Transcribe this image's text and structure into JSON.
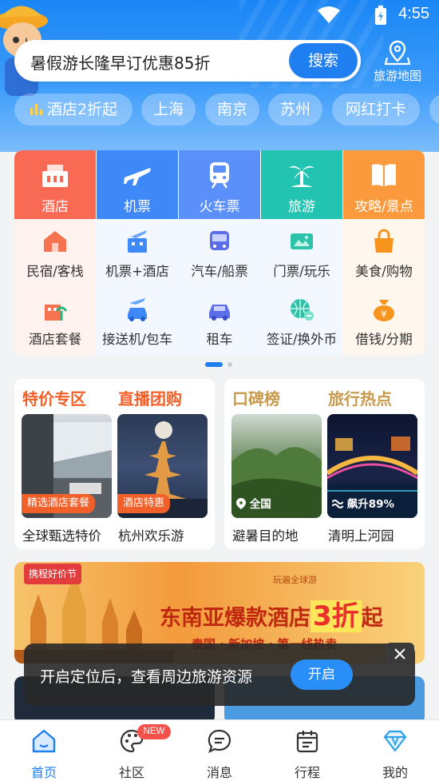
{
  "status_bar": {
    "time": "4:55"
  },
  "search": {
    "placeholder": "暑假游长隆早订优惠85折",
    "button": "搜索"
  },
  "map_button": {
    "label": "旅游地图"
  },
  "quick_tags": [
    "酒店2折起",
    "上海",
    "南京",
    "苏州",
    "网红打卡"
  ],
  "top_services": [
    {
      "label": "酒店",
      "color": "#f96a55",
      "icon": "hotel-icon"
    },
    {
      "label": "机票",
      "color": "#3f88f8",
      "icon": "plane-icon"
    },
    {
      "label": "火车票",
      "color": "#5b8ff9",
      "icon": "train-icon"
    },
    {
      "label": "旅游",
      "color": "#22c4b1",
      "icon": "palm-icon"
    },
    {
      "label": "攻略/景点",
      "color": "#fb9a3c",
      "icon": "book-icon"
    }
  ],
  "sub_services": [
    [
      {
        "label": "民宿/客栈",
        "icon": "house-icon"
      },
      {
        "label": "机票+酒店",
        "icon": "plane-hotel-icon"
      },
      {
        "label": "汽车/船票",
        "icon": "bus-icon"
      },
      {
        "label": "门票/玩乐",
        "icon": "ticket-icon"
      },
      {
        "label": "美食/购物",
        "icon": "shopping-bag-icon"
      }
    ],
    [
      {
        "label": "酒店套餐",
        "icon": "hotel-package-icon"
      },
      {
        "label": "接送机/包车",
        "icon": "airport-transfer-icon"
      },
      {
        "label": "租车",
        "icon": "car-icon"
      },
      {
        "label": "签证/换外币",
        "icon": "visa-icon"
      },
      {
        "label": "借钱/分期",
        "icon": "money-bag-icon"
      }
    ]
  ],
  "promo_left": {
    "title1": "特价专区",
    "title2": "直播团购",
    "items": [
      {
        "badge": "精选酒店套餐",
        "caption": "全球甄选特价"
      },
      {
        "badge": "酒店特惠",
        "caption": "杭州欢乐游"
      }
    ]
  },
  "promo_right": {
    "title1": "口碑榜",
    "title2": "旅行热点",
    "items": [
      {
        "badge": "全国",
        "caption": "避暑目的地"
      },
      {
        "badge": "飙升89%",
        "caption": "清明上河园"
      }
    ]
  },
  "banner": {
    "tag": "携程好价节",
    "headline_prefix": "东南亚爆款酒店",
    "headline_num": "3折",
    "headline_suffix": "起",
    "sub": "泰国 · 新加坡 · 第一线热卖",
    "logo_text": "玩遍全球游"
  },
  "toast": {
    "text": "开启定位后，查看周边旅游资源",
    "button": "开启"
  },
  "tab_bar": [
    {
      "label": "首页",
      "active": true
    },
    {
      "label": "社区",
      "badge": "NEW"
    },
    {
      "label": "消息"
    },
    {
      "label": "行程"
    },
    {
      "label": "我的"
    }
  ],
  "colors": {
    "accent": "#1f7ff0",
    "orange": "#f2602a"
  }
}
